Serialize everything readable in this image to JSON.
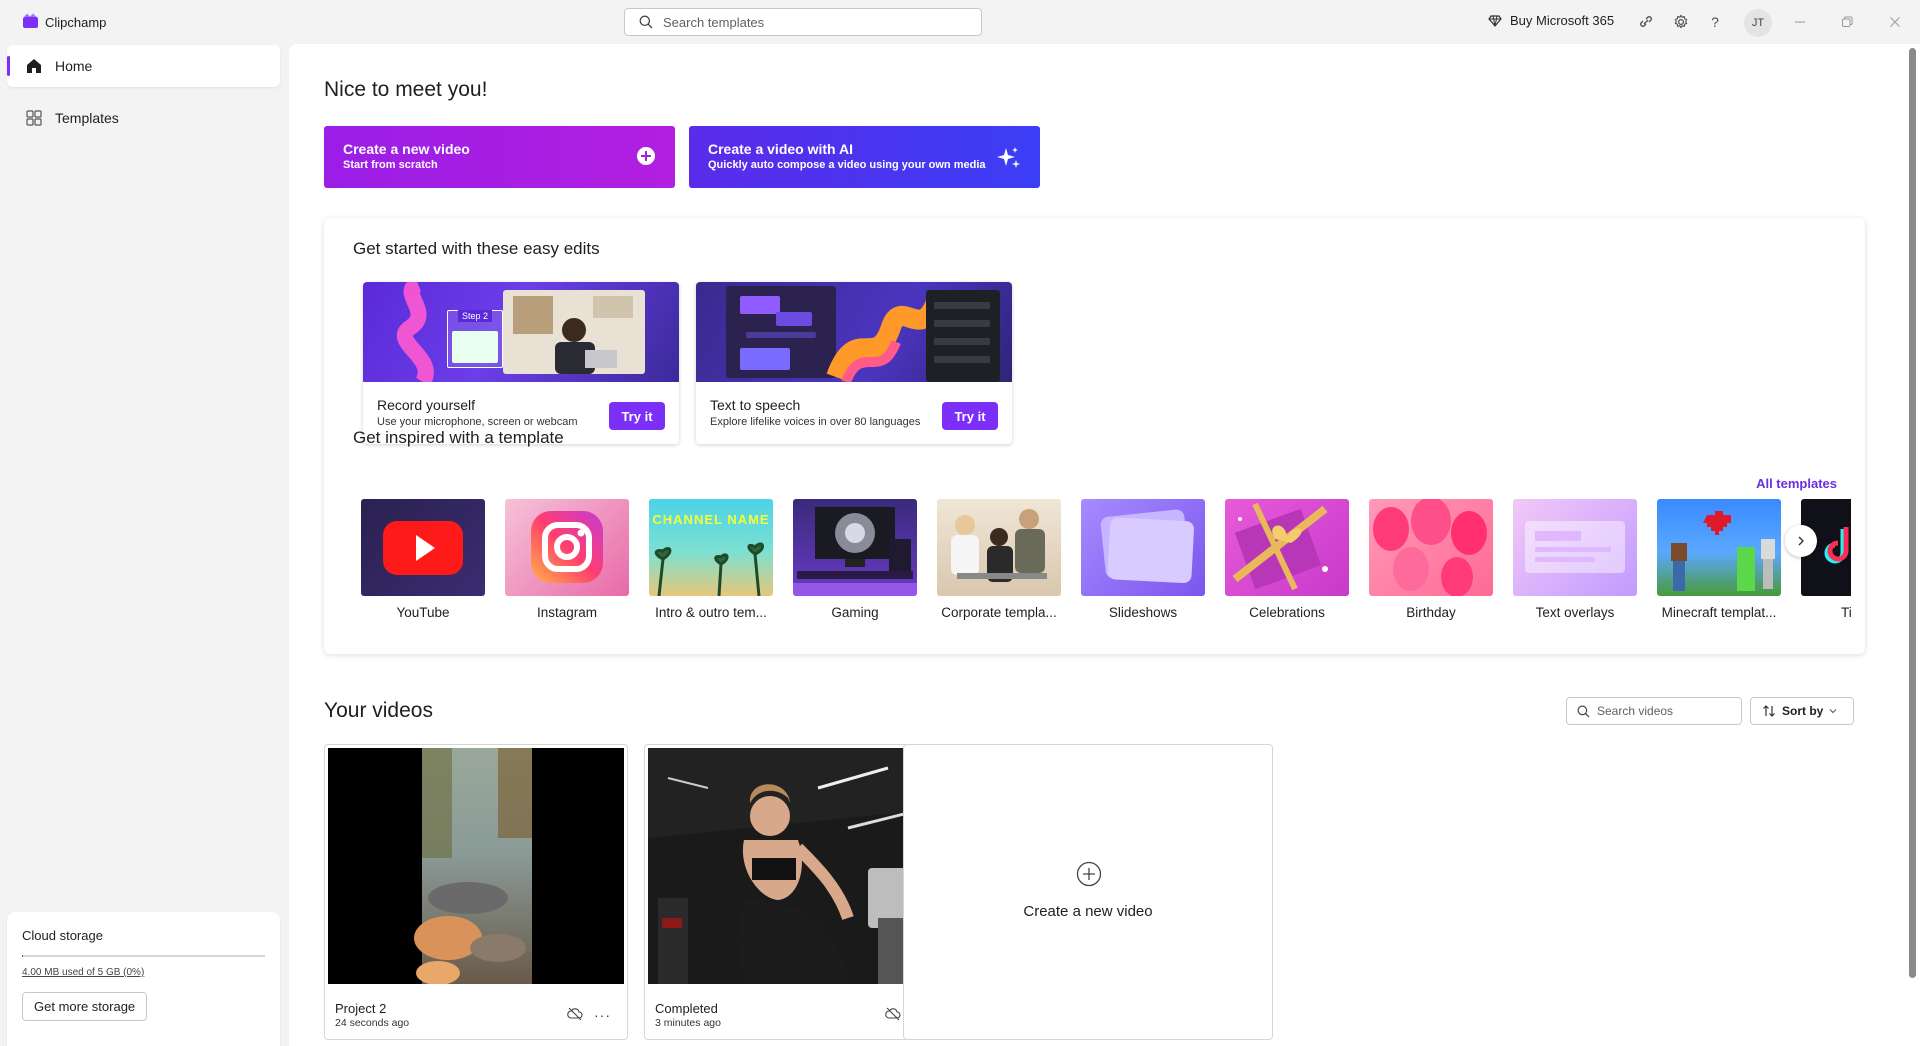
{
  "app": {
    "name": "Clipchamp"
  },
  "titlebar": {
    "search_placeholder": "Search templates",
    "buy_label": "Buy Microsoft 365",
    "avatar_initials": "JT"
  },
  "sidebar": {
    "items": [
      {
        "label": "Home"
      },
      {
        "label": "Templates"
      }
    ],
    "storage": {
      "title": "Cloud storage",
      "used_label": "4.00 MB used of 5 GB (0%)",
      "used_fraction": 0.0008,
      "button_label": "Get more storage"
    }
  },
  "main": {
    "greeting": "Nice to meet you!",
    "cta": [
      {
        "title": "Create a new video",
        "subtitle": "Start from scratch"
      },
      {
        "title": "Create a video with AI",
        "subtitle": "Quickly auto compose a video using your own media"
      }
    ],
    "easy_edits": {
      "heading": "Get started with these easy edits",
      "cards": [
        {
          "title": "Record yourself",
          "subtitle": "Use your microphone, screen or webcam",
          "button": "Try it",
          "thumb_text": "Step 2"
        },
        {
          "title": "Text to speech",
          "subtitle": "Explore lifelike voices in over 80 languages",
          "button": "Try it"
        }
      ]
    },
    "templates": {
      "heading": "Get inspired with a template",
      "all_label": "All templates",
      "items": [
        {
          "label": "YouTube"
        },
        {
          "label": "Instagram"
        },
        {
          "label": "Intro & outro tem..."
        },
        {
          "label": "Gaming"
        },
        {
          "label": "Corporate templa..."
        },
        {
          "label": "Slideshows"
        },
        {
          "label": "Celebrations"
        },
        {
          "label": "Birthday"
        },
        {
          "label": "Text overlays"
        },
        {
          "label": "Minecraft templat..."
        },
        {
          "label": "TikT"
        }
      ],
      "intro_thumb_text": "CHANNEL NAME"
    },
    "videos": {
      "heading": "Your videos",
      "search_placeholder": "Search videos",
      "sort_label": "Sort by",
      "items": [
        {
          "title": "Project 2",
          "time": "24 seconds ago"
        },
        {
          "title": "Completed",
          "time": "3 minutes ago"
        }
      ],
      "new_video_label": "Create a new video"
    }
  },
  "colors": {
    "accent": "#7b2ff7",
    "cta_primary": "#a21fe4",
    "cta_ai": "#4b35f0",
    "link": "#6b2fe0"
  }
}
